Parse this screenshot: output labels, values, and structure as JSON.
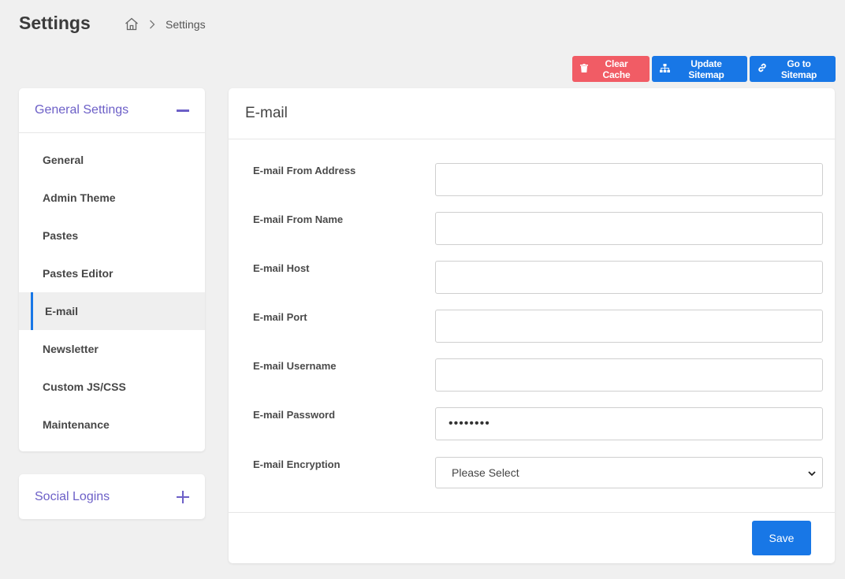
{
  "header": {
    "title": "Settings",
    "breadcrumb": {
      "current": "Settings"
    }
  },
  "actions": {
    "clear_cache": "Clear Cache",
    "update_sitemap": "Update Sitemap",
    "go_to_sitemap": "Go to Sitemap"
  },
  "sidebar": {
    "general_group": {
      "label": "General Settings",
      "items": [
        {
          "label": "General"
        },
        {
          "label": "Admin Theme"
        },
        {
          "label": "Pastes"
        },
        {
          "label": "Pastes Editor"
        },
        {
          "label": "E-mail",
          "active": true
        },
        {
          "label": "Newsletter"
        },
        {
          "label": "Custom JS/CSS"
        },
        {
          "label": "Maintenance"
        }
      ]
    },
    "social_group": {
      "label": "Social Logins"
    }
  },
  "main": {
    "title": "E-mail",
    "fields": {
      "from_address": {
        "label": "E-mail From Address",
        "value": ""
      },
      "from_name": {
        "label": "E-mail From Name",
        "value": ""
      },
      "host": {
        "label": "E-mail Host",
        "value": ""
      },
      "port": {
        "label": "E-mail Port",
        "value": ""
      },
      "username": {
        "label": "E-mail Username",
        "value": ""
      },
      "password": {
        "label": "E-mail Password",
        "value": "••••••••"
      },
      "encryption": {
        "label": "E-mail Encryption",
        "selected": "Please Select"
      }
    },
    "save_label": "Save"
  },
  "colors": {
    "accent": "#1877e6",
    "danger": "#f15c65",
    "sidebar_heading": "#6c5fc7"
  }
}
